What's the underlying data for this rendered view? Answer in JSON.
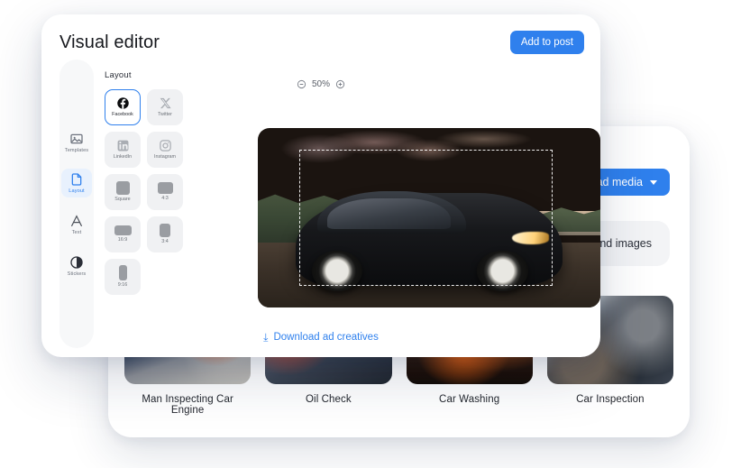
{
  "modal": {
    "title": "Visual editor",
    "add_to_post_label": "Add to post",
    "download_label": "Download ad creatives",
    "download_icon": "download-arrow-icon",
    "zoom": {
      "level": "50%",
      "zoom_out_icon": "minus-circle-icon",
      "zoom_in_icon": "plus-circle-icon"
    },
    "rail": {
      "items": [
        {
          "label": "Templates",
          "icon": "image-icon",
          "active": false
        },
        {
          "label": "Layout",
          "icon": "file-layout-icon",
          "active": true
        },
        {
          "label": "Text",
          "icon": "text-a-icon",
          "active": false
        },
        {
          "label": "Stickers",
          "icon": "contrast-circle-icon",
          "active": false
        }
      ]
    },
    "panel": {
      "title": "Layout",
      "options": [
        {
          "label": "Facebook",
          "icon": "facebook-icon",
          "selected": true
        },
        {
          "label": "Twitter",
          "icon": "twitter-x-icon",
          "selected": false
        },
        {
          "label": "LinkedIn",
          "icon": "linkedin-icon",
          "selected": false
        },
        {
          "label": "Instagram",
          "icon": "instagram-icon",
          "selected": false
        },
        {
          "label": "Square",
          "icon": "ratio-square-icon",
          "selected": false
        },
        {
          "label": "4:3",
          "icon": "ratio-4-3-icon",
          "selected": false
        },
        {
          "label": "16:9",
          "icon": "ratio-16-9-icon",
          "selected": false
        },
        {
          "label": "3:4",
          "icon": "ratio-3-4-icon",
          "selected": false
        },
        {
          "label": "9:16",
          "icon": "ratio-9-16-icon",
          "selected": false
        }
      ]
    },
    "canvas": {
      "description": "Black hatchback car parked at sunset by the water",
      "crop_selection": "dashed-crop-rectangle"
    }
  },
  "background_card": {
    "upload_media_label": "Upload media",
    "upload_media_caret": "chevron-down-icon",
    "chip_label": "Background images",
    "thumbnails": [
      {
        "caption": "Man Inspecting Car Engine"
      },
      {
        "caption": "Oil Check"
      },
      {
        "caption": "Car Washing"
      },
      {
        "caption": "Car Inspection"
      }
    ]
  },
  "colors": {
    "accent": "#2f80ed",
    "panel_chip": "#f0f1f3",
    "rail_bg": "#f7f8f9",
    "text_primary": "#16181d",
    "text_muted": "#6c727d"
  }
}
